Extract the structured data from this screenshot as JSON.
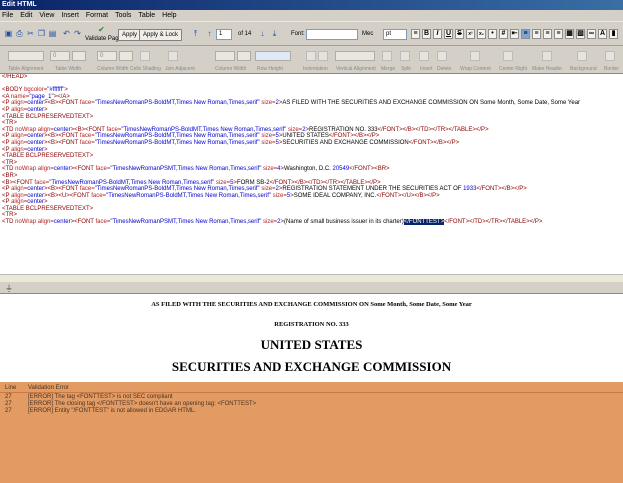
{
  "window": {
    "title": "Edit HTML"
  },
  "menu": [
    "File",
    "Edit",
    "View",
    "Insert",
    "Format",
    "Tools",
    "Table",
    "Help"
  ],
  "toolbar": {
    "validate_label": "Validate Page",
    "apply_label": "Apply",
    "apply_lock_label": "Apply & Lock",
    "page_number": "1",
    "page_of": "of 14",
    "font_label": "Font:",
    "font_value": "",
    "size_value": "Mec",
    "unit_value": "pt"
  },
  "toolbar2_labels": [
    "Table Alignment",
    "Table Width",
    "Column Width",
    "Cells Shading",
    "Join Adjacent",
    "Column Width",
    "Row Height",
    "Indentation",
    "Vertical Alignment",
    "Merge",
    "Split",
    "Insert",
    "Delete",
    "Wrap Content",
    "Center Right",
    "Make Header",
    "Background",
    "Border"
  ],
  "toolbar2_values": {
    "table_width": "0",
    "cell_width": "0"
  },
  "source_lines": [
    [
      [
        "tag",
        "</HEAD>"
      ]
    ],
    [],
    [
      [
        "tag",
        "<BODY "
      ],
      [
        "attr",
        "bgcolor="
      ],
      [
        "val",
        "\"#ffffff\""
      ],
      [
        "tag",
        ">"
      ]
    ],
    [
      [
        "tag",
        "<A "
      ],
      [
        "attr",
        "name="
      ],
      [
        "val",
        "\"page_1\""
      ],
      [
        "tag",
        "></A>"
      ]
    ],
    [
      [
        "tag",
        "<P "
      ],
      [
        "attr",
        "align="
      ],
      [
        "val",
        "center"
      ],
      [
        "tag",
        "><B><FONT "
      ],
      [
        "attr",
        "face="
      ],
      [
        "val",
        "\"TimesNewRomanPS-BoldMT,Times New Roman,Times,serif\""
      ],
      [
        "attr",
        " size="
      ],
      [
        "val",
        "2"
      ],
      [
        "tag",
        ">"
      ],
      [
        "txt",
        "AS FILED WITH THE SECURITIES AND EXCHANGE COMMISSION ON Some Month, Some Date, Some Year"
      ]
    ],
    [
      [
        "tag",
        "<P "
      ],
      [
        "attr",
        "align="
      ],
      [
        "val",
        "center"
      ],
      [
        "tag",
        ">"
      ]
    ],
    [
      [
        "tag",
        "<TABLE BCLPRESERVEDTEXT>"
      ]
    ],
    [
      [
        "tag",
        "<TR>"
      ]
    ],
    [
      [
        "txt",
        "   "
      ],
      [
        "tag",
        "<TD "
      ],
      [
        "attr",
        "noWrap align="
      ],
      [
        "val",
        "center"
      ],
      [
        "tag",
        "><B><FONT "
      ],
      [
        "attr",
        "face="
      ],
      [
        "val",
        "\"TimesNewRomanPS-BoldMT,Times New Roman,Times,serif\""
      ],
      [
        "attr",
        " size="
      ],
      [
        "val",
        "2"
      ],
      [
        "tag",
        ">"
      ],
      [
        "txt",
        "REGISTRATION NO. 333"
      ],
      [
        "tag",
        "</FONT></B></TD></TR></TABLE></P>"
      ]
    ],
    [
      [
        "tag",
        "<P "
      ],
      [
        "attr",
        "align="
      ],
      [
        "val",
        "center"
      ],
      [
        "tag",
        "><B><FONT "
      ],
      [
        "attr",
        "face="
      ],
      [
        "val",
        "\"TimesNewRomanPS-BoldMT,Times New Roman,Times,serif\""
      ],
      [
        "attr",
        " size="
      ],
      [
        "val",
        "5"
      ],
      [
        "tag",
        ">"
      ],
      [
        "txt",
        "UNITED STATES"
      ],
      [
        "tag",
        "</FONT></B></P>"
      ]
    ],
    [
      [
        "tag",
        "<P "
      ],
      [
        "attr",
        "align="
      ],
      [
        "val",
        "center"
      ],
      [
        "tag",
        "><B><FONT "
      ],
      [
        "attr",
        "face="
      ],
      [
        "val",
        "\"TimesNewRomanPS-BoldMT,Times New Roman,Times,serif\""
      ],
      [
        "attr",
        " size="
      ],
      [
        "val",
        "5"
      ],
      [
        "tag",
        ">"
      ],
      [
        "txt",
        "SECURITIES AND EXCHANGE COMMISSION"
      ],
      [
        "tag",
        "</FONT></B></P>"
      ]
    ],
    [
      [
        "tag",
        "<P "
      ],
      [
        "attr",
        "align="
      ],
      [
        "val",
        "center"
      ],
      [
        "tag",
        ">"
      ]
    ],
    [
      [
        "tag",
        "<TABLE BCLPRESERVEDTEXT>"
      ]
    ],
    [
      [
        "tag",
        "<TR>"
      ]
    ],
    [
      [
        "txt",
        "   "
      ],
      [
        "tag",
        "<TD "
      ],
      [
        "attr",
        "noWrap align="
      ],
      [
        "val",
        "center"
      ],
      [
        "tag",
        "><FONT "
      ],
      [
        "attr",
        "face="
      ],
      [
        "val",
        "\"TimesNewRomanPSMT,Times New Roman,Times,serif\""
      ],
      [
        "attr",
        " size="
      ],
      [
        "val",
        "4"
      ],
      [
        "tag",
        ">"
      ],
      [
        "txt",
        "Washington, D.C. "
      ],
      [
        "val",
        "20549"
      ],
      [
        "tag",
        "</FONT><BR>"
      ]
    ],
    [
      [
        "tag",
        "<BR>"
      ]
    ],
    [
      [
        "tag",
        "<B><FONT "
      ],
      [
        "attr",
        "face="
      ],
      [
        "val",
        "\"TimesNewRomanPS-BoldMT,Times New Roman,Times,serif\""
      ],
      [
        "attr",
        " size="
      ],
      [
        "val",
        "5"
      ],
      [
        "tag",
        ">"
      ],
      [
        "txt",
        "FORM SB-2"
      ],
      [
        "tag",
        "</FONT></B></TD></TR></TABLE></P>"
      ]
    ],
    [
      [
        "tag",
        "<P "
      ],
      [
        "attr",
        "align="
      ],
      [
        "val",
        "center"
      ],
      [
        "tag",
        "><B><FONT "
      ],
      [
        "attr",
        "face="
      ],
      [
        "val",
        "\"TimesNewRomanPS-BoldMT,Times New Roman,Times,serif\""
      ],
      [
        "attr",
        " size="
      ],
      [
        "val",
        "2"
      ],
      [
        "tag",
        ">"
      ],
      [
        "txt",
        "REGISTRATION STATEMENT UNDER THE SECURITIES ACT OF "
      ],
      [
        "val",
        "1933"
      ],
      [
        "tag",
        "</FONT></B></P>"
      ]
    ],
    [
      [
        "tag",
        "<P "
      ],
      [
        "attr",
        "align="
      ],
      [
        "val",
        "center"
      ],
      [
        "tag",
        "><B><U><FONT "
      ],
      [
        "attr",
        "face="
      ],
      [
        "val",
        "\"TimesNewRomanPS-BoldMT,Times New Roman,Times,serif\""
      ],
      [
        "attr",
        " size="
      ],
      [
        "val",
        "5"
      ],
      [
        "tag",
        ">"
      ],
      [
        "txt",
        "SOME IDEAL COMPANY, INC."
      ],
      [
        "tag",
        "</FONT></U></B></P>"
      ]
    ],
    [
      [
        "tag",
        "<P "
      ],
      [
        "attr",
        "align="
      ],
      [
        "val",
        "center"
      ],
      [
        "tag",
        ">"
      ]
    ],
    [
      [
        "tag",
        "<TABLE BCLPRESERVEDTEXT>"
      ]
    ],
    [
      [
        "tag",
        "<TR>"
      ]
    ],
    [
      [
        "txt",
        "   "
      ],
      [
        "tag",
        "<TD "
      ],
      [
        "attr",
        "noWrap align="
      ],
      [
        "val",
        "center"
      ],
      [
        "tag",
        "><FONT "
      ],
      [
        "attr",
        "face="
      ],
      [
        "val",
        "\"TimesNewRomanPSMT,Times New Roman,Times,serif\""
      ],
      [
        "attr",
        " size="
      ],
      [
        "val",
        "2"
      ],
      [
        "tag",
        ">"
      ],
      [
        "txt",
        "(Name of small business issuer in its charter)"
      ],
      [
        "sel",
        "</FONTTEST>"
      ],
      [
        "tag",
        "</FONT></TD></TR></TABLE></P>"
      ]
    ]
  ],
  "preview": {
    "line1": "AS FILED WITH THE SECURITIES AND EXCHANGE COMMISSION ON Some Month, Some Date, Some Year",
    "line2": "REGISTRATION NO. 333",
    "line3": "UNITED STATES",
    "line4": "SECURITIES AND EXCHANGE COMMISSION"
  },
  "validation": {
    "col_line": "Line",
    "col_msg": "Validation Error",
    "rows": [
      {
        "line": "27",
        "msg": "[ERROR] The tag <FONTTEST> is not SEC compliant"
      },
      {
        "line": "27",
        "msg": "[ERROR] The closing tag </FONTTEST> doesn't have an opening tag: <FONTTEST>"
      },
      {
        "line": "27",
        "msg": "[ERROR] Entity \"/FONTTEST\" is not allowed in EDGAR HTML."
      }
    ]
  },
  "colors": {
    "error_panel": "#e39b64",
    "selection": "#0a246a",
    "title_bar": "#0a246a"
  }
}
